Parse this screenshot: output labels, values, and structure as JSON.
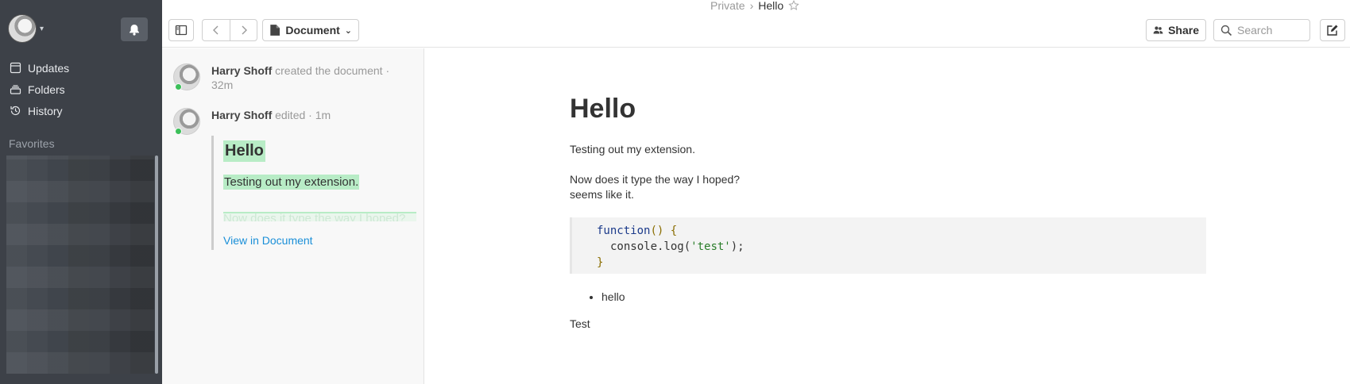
{
  "header": {
    "breadcrumb_parent": "Private",
    "breadcrumb_current": "Hello",
    "document_label": "Document",
    "share_label": "Share",
    "search_placeholder": "Search"
  },
  "sidebar": {
    "nav": [
      {
        "label": "Updates"
      },
      {
        "label": "Folders"
      },
      {
        "label": "History"
      }
    ],
    "favorites_title": "Favorites"
  },
  "updates": [
    {
      "author": "Harry Shoff",
      "action": "created the document",
      "time": "32m"
    },
    {
      "author": "Harry Shoff",
      "action": "edited",
      "time": "1m",
      "diff_heading": "Hello",
      "diff_line": "Testing out my extension.",
      "diff_faded": "Now does it type the way I hoped?",
      "view_link": "View in Document"
    }
  ],
  "document": {
    "title": "Hello",
    "para1": "Testing out my extension.",
    "para2_line1": "Now does it type the way I hoped?",
    "para2_line2": "seems like it.",
    "code": {
      "line1_kw": "function",
      "line1_rest": "() {",
      "line2_call": "console.log(",
      "line2_str": "'test'",
      "line2_end": ");",
      "line3": "}"
    },
    "bullet": "hello",
    "last": "Test"
  }
}
